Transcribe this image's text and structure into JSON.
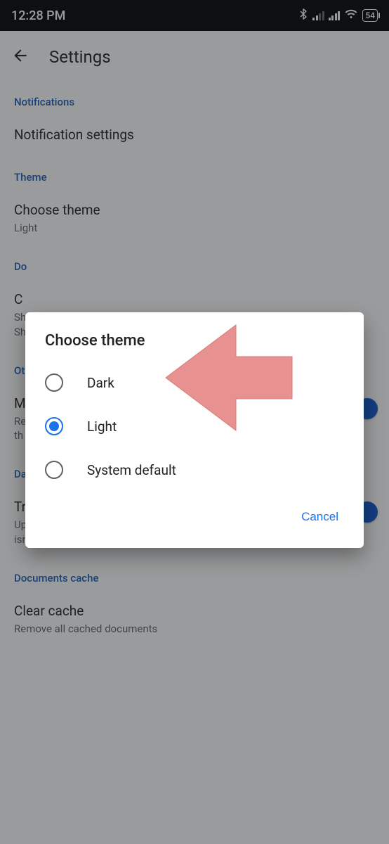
{
  "status": {
    "time": "12:28 PM",
    "battery": "54"
  },
  "header": {
    "title": "Settings"
  },
  "sections": {
    "notifications": {
      "label": "Notifications",
      "row_title": "Notification settings"
    },
    "theme": {
      "label": "Theme",
      "row_title": "Choose theme",
      "row_sub": "Light"
    },
    "downloads": {
      "label": "Do",
      "row_title": "C",
      "row_sub1": "Sh",
      "row_sub2": "Sh"
    },
    "other": {
      "label": "Ot",
      "row_title": "M",
      "row_sub1": "Re",
      "row_sub2": "th"
    },
    "data_usage": {
      "label": "Data usage",
      "row_title": "Transfer files only over Wi-Fi",
      "row_sub": "Uploading and updating of files will pause when Wi-Fi connection isn't available."
    },
    "cache": {
      "label": "Documents cache",
      "row_title": "Clear cache",
      "row_sub": "Remove all cached documents"
    }
  },
  "dialog": {
    "title": "Choose theme",
    "options": {
      "dark": "Dark",
      "light": "Light",
      "system": "System default"
    },
    "selected": "light",
    "cancel": "Cancel"
  }
}
